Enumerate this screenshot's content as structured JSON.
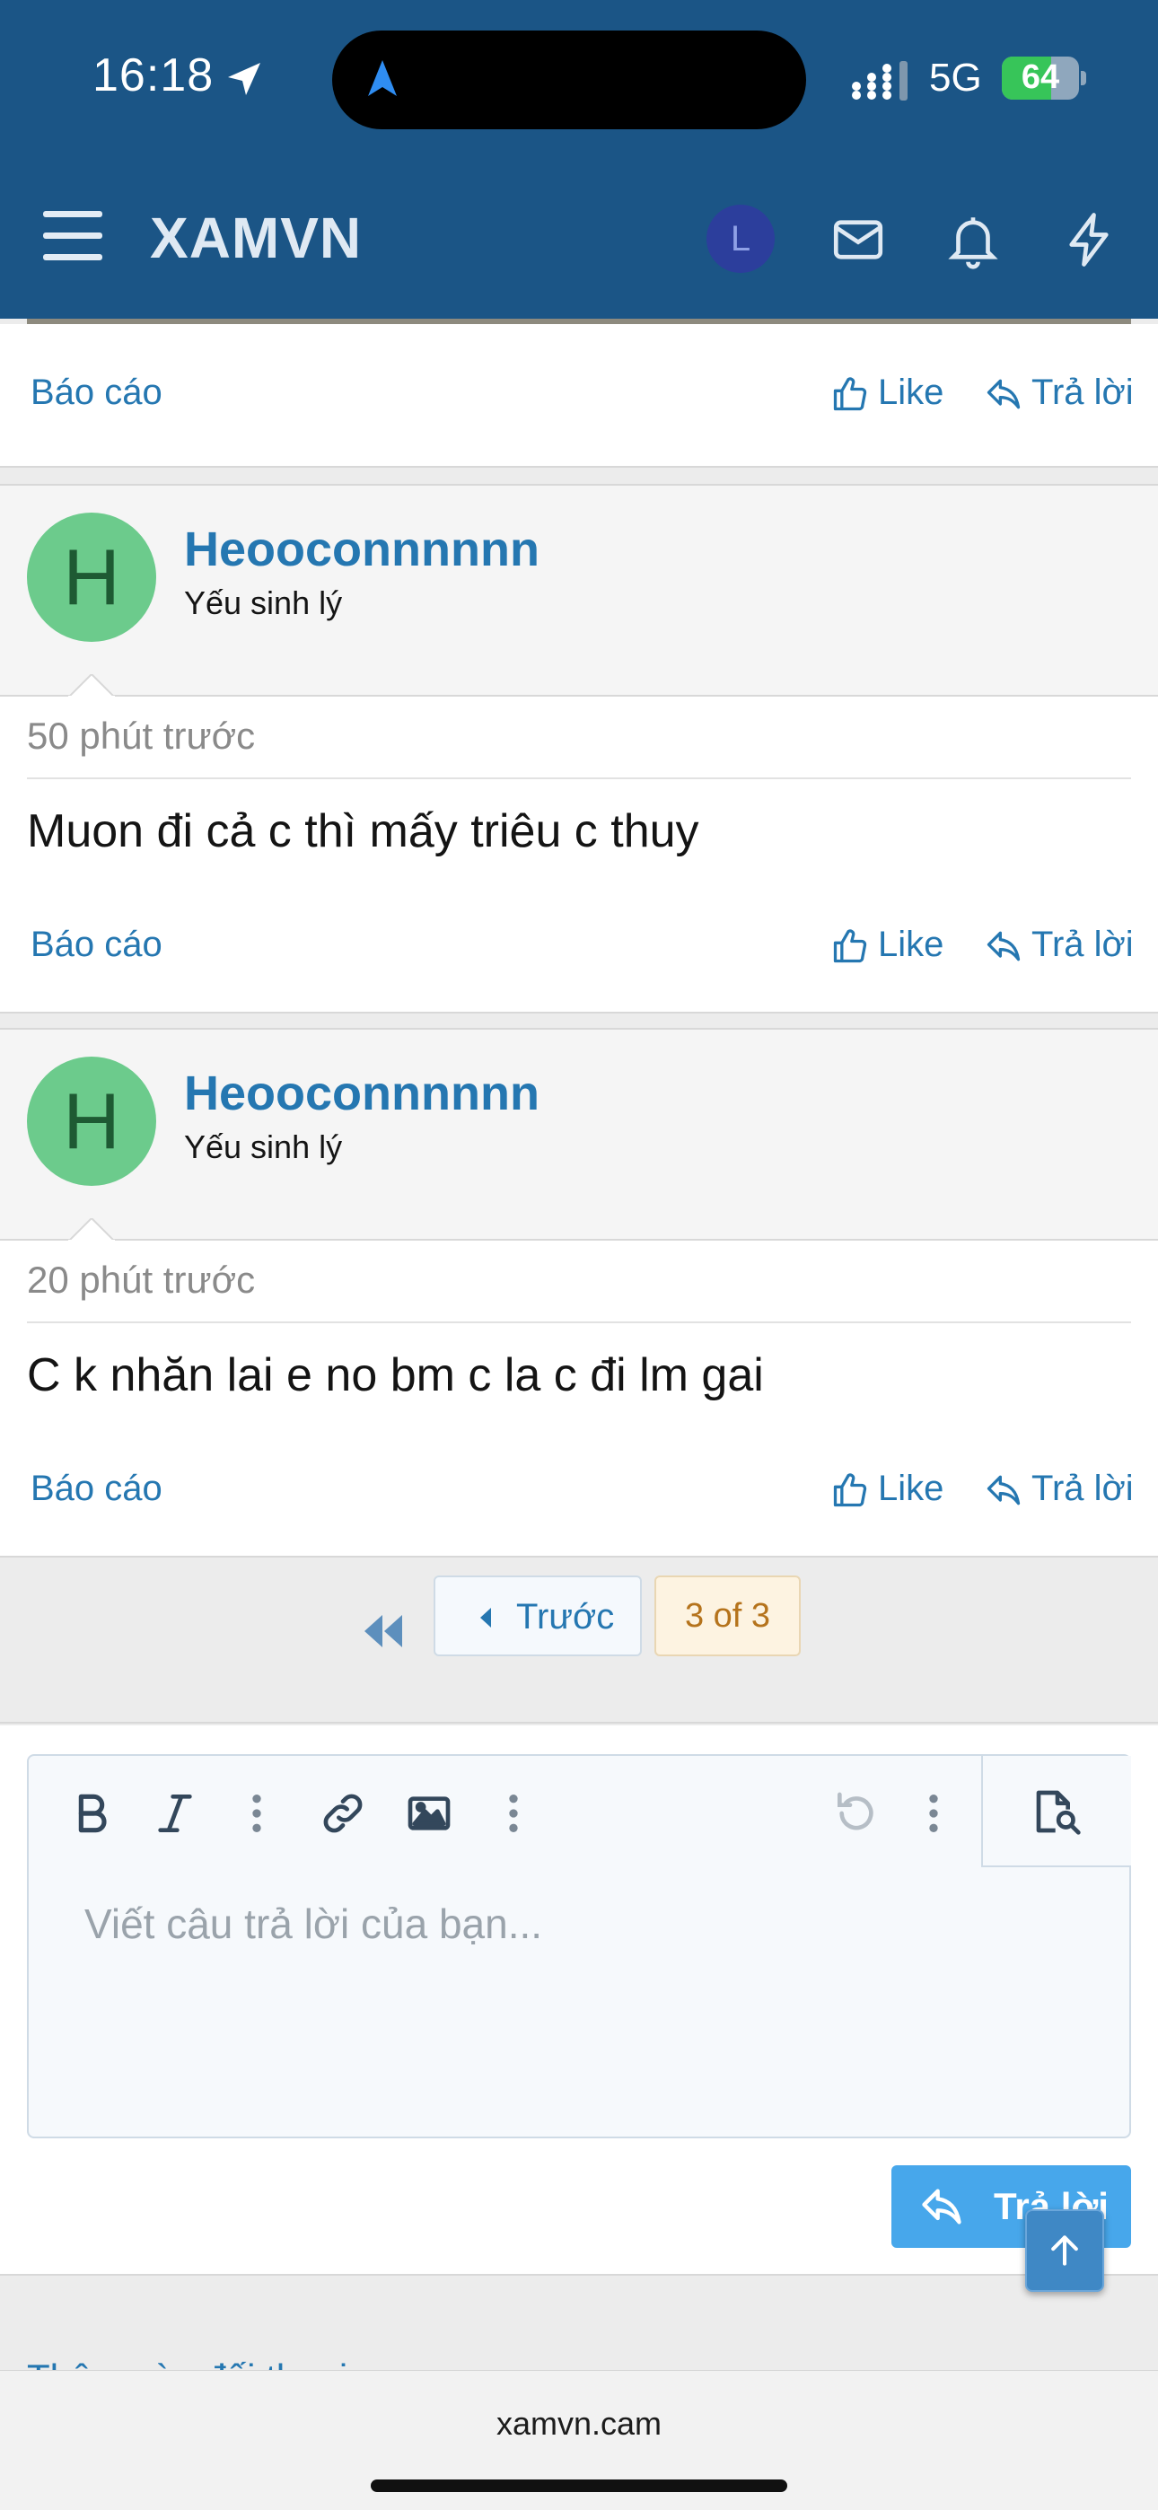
{
  "status_bar": {
    "time": "16:18",
    "network": "5G",
    "battery_level": "64",
    "battery_fill": 0.64
  },
  "nav": {
    "site_name": "XAMVN",
    "user_initial": "L"
  },
  "posts": [
    {
      "report": "Báo cáo",
      "like": "Like",
      "reply": "Trả lời"
    },
    {
      "avatar_letter": "H",
      "username": "Heooconnnnnn",
      "user_title": "Yếu sinh lý",
      "time": "50 phút trước",
      "text": "Muon đi cả c thì mấy triêu c thuy",
      "report": "Báo cáo",
      "like": "Like",
      "reply": "Trả lời"
    },
    {
      "avatar_letter": "H",
      "username": "Heooconnnnnn",
      "user_title": "Yếu sinh lý",
      "time": "20 phút trước",
      "text": "C k nhăn lai e no bm c la c đi lm gai",
      "report": "Báo cáo",
      "like": "Like",
      "reply": "Trả lời"
    }
  ],
  "pagination": {
    "prev_label": "Trước",
    "current": "3 of 3"
  },
  "editor": {
    "placeholder": "Viết câu trả lời của bạn...",
    "submit_label": "Trả lời"
  },
  "footer_link": "Thêm vào đối thoại",
  "browser": {
    "url": "xamvn.cam"
  },
  "colors": {
    "header": "#1b5586",
    "link": "#2577b1",
    "avatar": "#6ccb8c",
    "reply_button": "#47a7eb"
  }
}
